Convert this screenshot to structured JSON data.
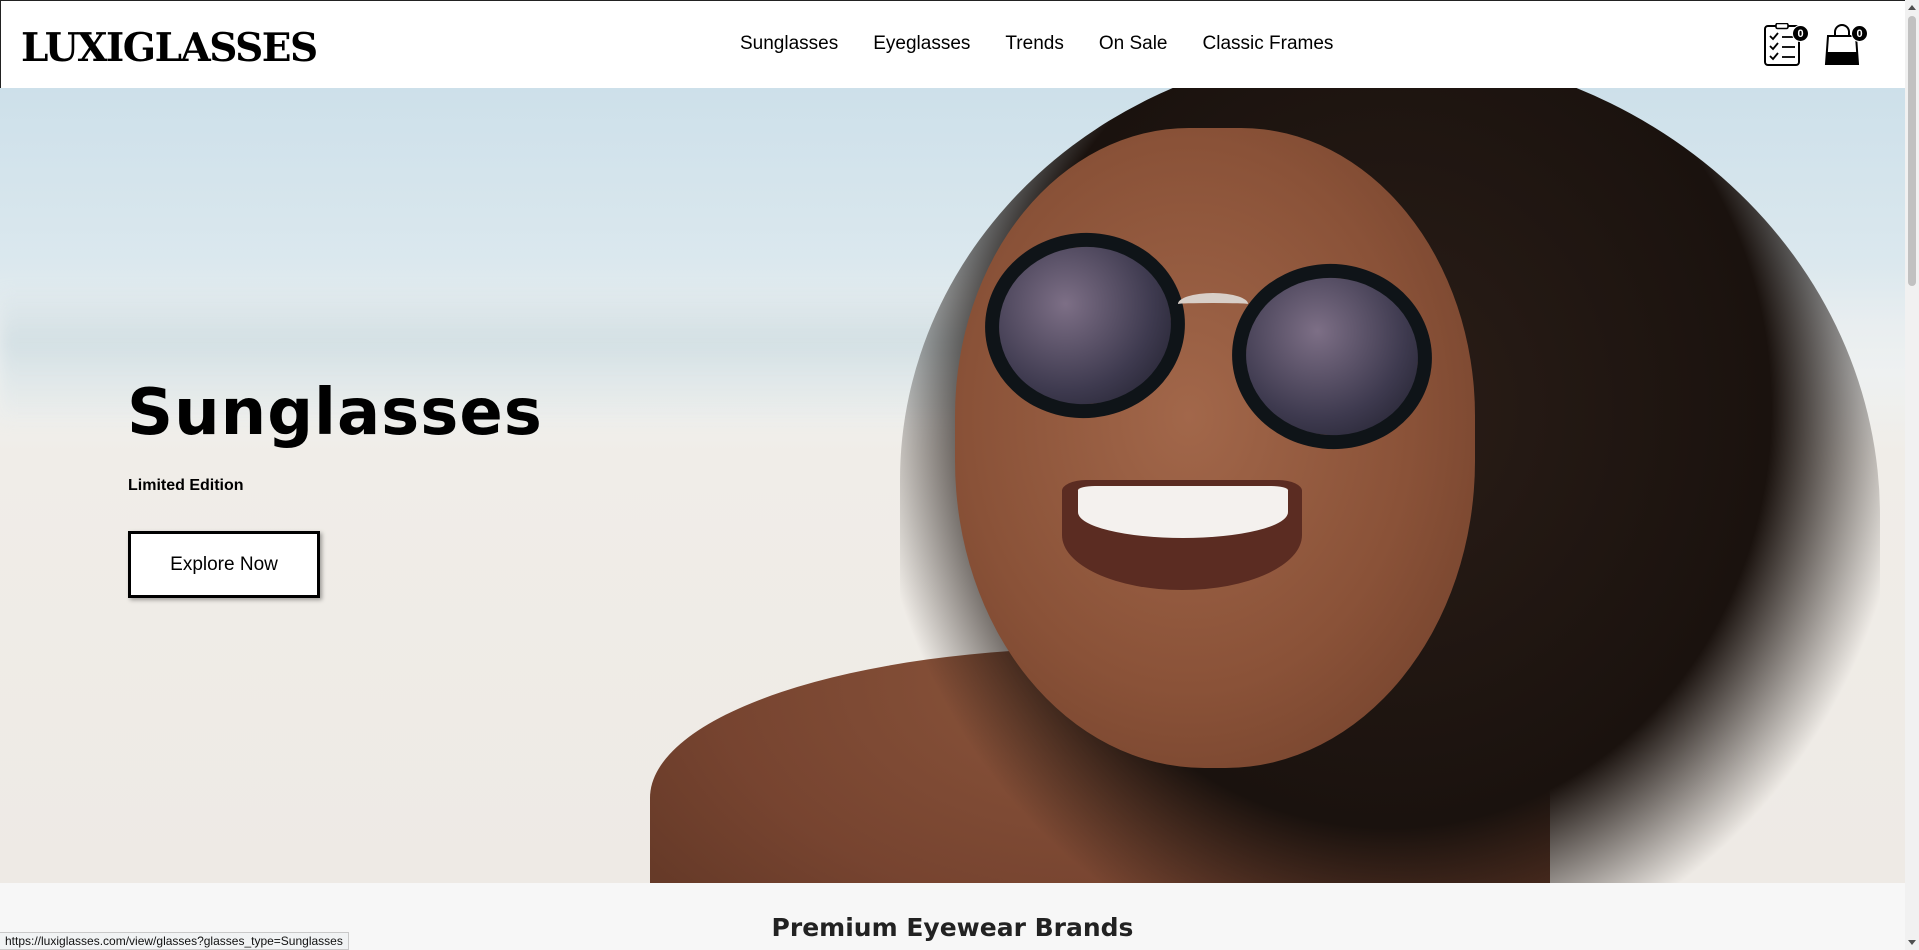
{
  "header": {
    "logo": "LUXIGLASSES",
    "nav": [
      "Sunglasses",
      "Eyeglasses",
      "Trends",
      "On Sale",
      "Classic Frames"
    ],
    "wishlist_count": "0",
    "cart_count": "0"
  },
  "hero": {
    "title": "Sunglasses",
    "subtitle": "Limited Edition",
    "button_label": "Explore Now"
  },
  "brands": {
    "title": "Premium Eyewear Brands"
  },
  "status_bar": {
    "url": "https://luxiglasses.com/view/glasses?glasses_type=Sunglasses"
  }
}
